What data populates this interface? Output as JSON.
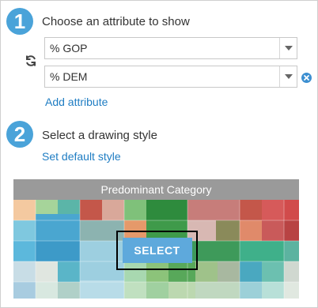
{
  "step1": {
    "number": "1",
    "title": "Choose an attribute to show",
    "attribute1": {
      "value": "% GOP"
    },
    "attribute2": {
      "value": "% DEM"
    },
    "add_attribute_label": "Add attribute"
  },
  "step2": {
    "number": "2",
    "title": "Select a drawing style",
    "set_default_label": "Set default style"
  },
  "style_card": {
    "name": "Predominant Category",
    "select_label": "SELECT"
  },
  "colors": {
    "accent": "#4aa3d9",
    "link": "#1f7dc3",
    "remove_icon": "#3c8fd1"
  },
  "icons": {
    "swap": "refresh-icon",
    "dropdown": "chevron-down-icon",
    "remove": "close-circle-icon"
  }
}
